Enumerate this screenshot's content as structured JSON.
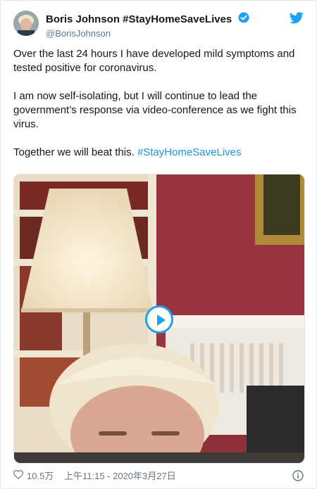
{
  "user": {
    "display_name": "Boris Johnson #StayHomeSaveLives",
    "handle": "@BorisJohnson"
  },
  "tweet": {
    "paragraph_1": "Over the last 24 hours I have developed mild symptoms and tested positive for coronavirus.",
    "paragraph_2": "I am now self-isolating, but I will continue to lead the government’s response via video-conference as we fight this virus.",
    "paragraph_3_text": "Together we will beat this. ",
    "hashtag": "#StayHomeSaveLives"
  },
  "footer": {
    "like_count": "10.5万",
    "timestamp": "上午11:15 - 2020年3月27日"
  },
  "icons": {
    "verified": "verified-badge-icon",
    "brand": "twitter-bird-icon",
    "like": "heart-icon",
    "info": "info-icon",
    "play": "play-icon"
  },
  "colors": {
    "accent": "#1da1f2",
    "hashtag": "#1b95e0",
    "muted": "#657786"
  }
}
